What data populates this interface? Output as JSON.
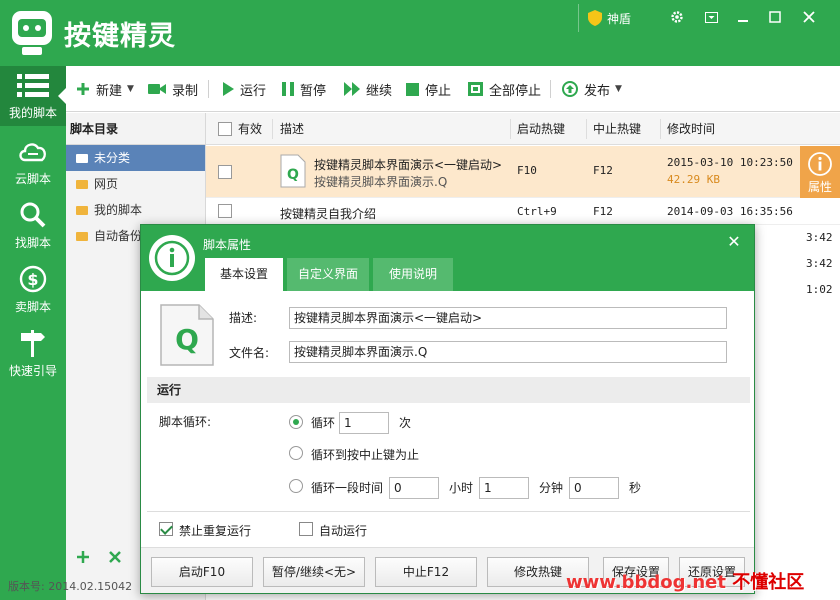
{
  "app": {
    "title": "按键精灵",
    "shield_label": "神盾"
  },
  "nav": [
    {
      "label": "我的脚本",
      "icon": "list-icon"
    },
    {
      "label": "云脚本",
      "icon": "cloud-icon"
    },
    {
      "label": "找脚本",
      "icon": "search-icon"
    },
    {
      "label": "卖脚本",
      "icon": "dollar-coin-icon"
    },
    {
      "label": "快速引导",
      "icon": "signpost-icon"
    }
  ],
  "toolbar": {
    "new": "新建",
    "record": "录制",
    "run": "运行",
    "pause": "暂停",
    "resume": "继续",
    "stop": "停止",
    "stop_all": "全部停止",
    "publish": "发布"
  },
  "tree": {
    "header": "脚本目录",
    "items": [
      "未分类",
      "网页",
      "我的脚本",
      "自动备份"
    ],
    "selected_index": 0
  },
  "list": {
    "columns": [
      "有效",
      "描述",
      "启动热键",
      "中止热键",
      "修改时间"
    ],
    "rows": [
      {
        "desc": "按键精灵脚本界面演示<一键启动>",
        "file": "按键精灵脚本界面演示.Q",
        "start": "F10",
        "stop": "F12",
        "time": "2015-03-10 10:23:50",
        "size": "42.29 KB"
      },
      {
        "desc": "按键精灵自我介绍",
        "start": "Ctrl+9",
        "stop": "F12",
        "time": "2014-09-03 16:35:56"
      }
    ],
    "partial_times": [
      "3:42",
      "3:42",
      "1:02"
    ],
    "attr_label": "属性"
  },
  "version": "版本号: 2014.02.15042",
  "dialog": {
    "title": "脚本属性",
    "tabs": [
      "基本设置",
      "自定义界面",
      "使用说明"
    ],
    "desc_label": "描述:",
    "desc_value": "按键精灵脚本界面演示<一键启动>",
    "filename_label": "文件名:",
    "filename_value": "按键精灵脚本界面演示.Q",
    "run_section": "运行",
    "loop_label": "脚本循环:",
    "loop_opt1": "循环",
    "loop_count": "1",
    "loop_unit": "次",
    "loop_opt2": "循环到按中止键为止",
    "loop_opt3": "循环一段时间",
    "hours": "0",
    "hours_unit": "小时",
    "minutes": "1",
    "minutes_unit": "分钟",
    "seconds": "0",
    "seconds_unit": "秒",
    "no_repeat": "禁止重复运行",
    "auto_run": "自动运行",
    "buttons": [
      "启动F10",
      "暂停/继续<无>",
      "中止F12",
      "修改热键",
      "保存设置",
      "还原设置"
    ]
  },
  "watermark": {
    "url": "www.bbdog.net",
    "cn": "不懂社区"
  },
  "colors": {
    "accent": "#2fa84f",
    "highlight_row": "#fde8cc",
    "attr_badge": "#f0a449"
  }
}
